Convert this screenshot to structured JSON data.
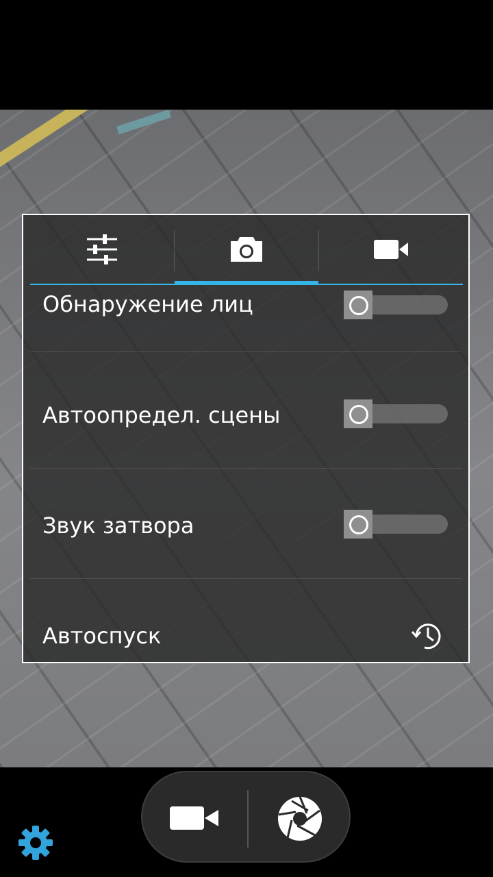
{
  "tabs": [
    {
      "name": "settings-tab",
      "icon": "sliders-icon"
    },
    {
      "name": "photo-tab",
      "icon": "camera-icon",
      "active": true
    },
    {
      "name": "video-tab",
      "icon": "video-camera-icon"
    }
  ],
  "settings": {
    "face_detection": {
      "label": "Обнаружение лиц",
      "enabled": false
    },
    "scene_detection": {
      "label": "Автоопредел. сцены",
      "enabled": false
    },
    "shutter_sound": {
      "label": "Звук затвора",
      "enabled": false
    },
    "self_timer": {
      "label": "Автоспуск",
      "icon": "timer-icon"
    }
  },
  "bottom": {
    "left_icon": "gear-icon",
    "mode_icon": "video-camera-icon",
    "shutter_icon": "shutter-icon"
  },
  "colors": {
    "accent": "#33b5e5",
    "panel_border": "#ffffff",
    "gear": "#33a3dc"
  }
}
